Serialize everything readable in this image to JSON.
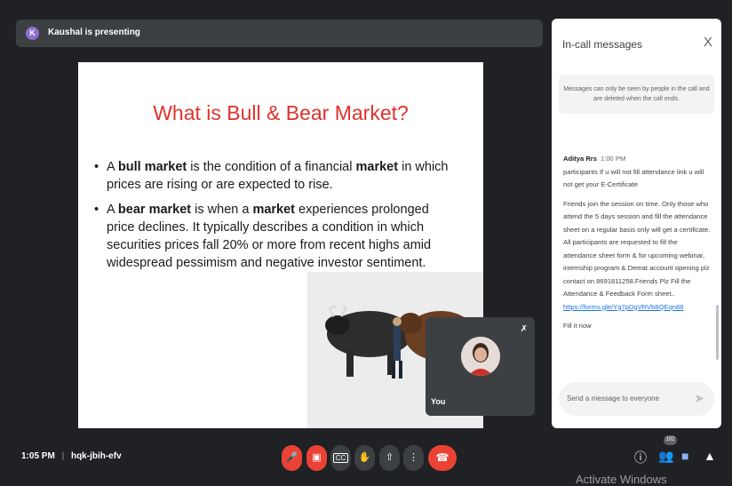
{
  "presenter": {
    "avatar_letter": "K",
    "label": "Kaushal is presenting"
  },
  "slide": {
    "title": "What is Bull & Bear Market?",
    "bullet1": {
      "p1": "A ",
      "b1": "bull market",
      "p2": " is the condition of a financial ",
      "b2": "market",
      "p3": " in which prices are rising or are expected to rise."
    },
    "bullet2": {
      "p1": "A ",
      "b1": "bear market",
      "p2": " is when a ",
      "b2": "market",
      "p3": " experiences prolonged price declines. It typically describes a condition in which securities prices fall 20% or more from recent highs amid widespread pessimism and negative investor sentiment."
    }
  },
  "self_tile": {
    "label": "You"
  },
  "chat": {
    "title": "In-call messages",
    "close": "X",
    "notice": "Messages can only be seen by people in the call and are deleted when the call ends.",
    "sender": "Aditya Rrs",
    "time": "1:00 PM",
    "msg1": "participants If u will not fill attendance link u will not get your E-Certificate",
    "msg2": "Friends join the session on time. Only those  who attend the 5 days session and fill the attendance sheet on a regular basis only will get a certificate. All participants are requested to fill the attendance sheet form & for upcoming webinar,  internship program & Demat account opening plz contact on 8691811258.Friends Plz Fill the Attendance & Feedback Form sheet..",
    "link": "https://forms.gle/Yg7pDgVRVb8QEqn88",
    "msg3": "Fill it now",
    "input_placeholder": "Send a message to everyone"
  },
  "bottom": {
    "time": "1:05 PM",
    "separator": "|",
    "meeting_code": "hqk-jbih-efv",
    "participant_count": "102",
    "watermark": "Activate Windows"
  },
  "icons": [
    "mic-off-icon",
    "camera-off-icon",
    "captions-icon",
    "raise-hand-icon",
    "present-icon",
    "more-icon",
    "end-call-icon",
    "info-icon",
    "people-icon",
    "chat-icon",
    "activities-icon",
    "send-icon"
  ]
}
